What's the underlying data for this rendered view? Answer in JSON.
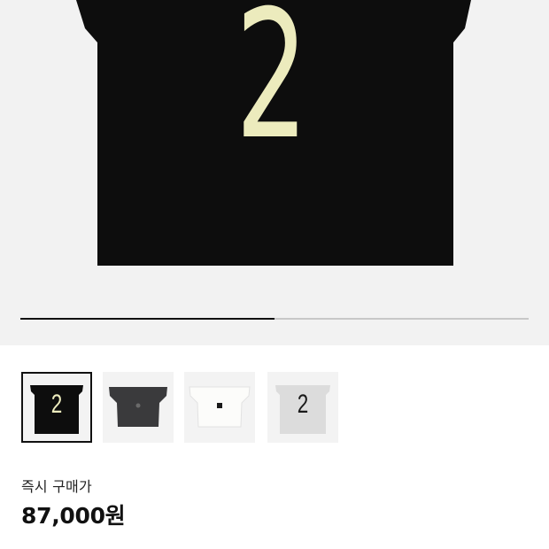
{
  "product": {
    "hero_number": "2",
    "image_progress_percent": 50
  },
  "thumbnails": [
    {
      "number": "2",
      "selected": true,
      "icon": "black-tshirt-front"
    },
    {
      "number": "",
      "selected": false,
      "icon": "charcoal-tshirt-back"
    },
    {
      "number": "",
      "selected": false,
      "icon": "white-tshirt"
    },
    {
      "number": "2",
      "selected": false,
      "icon": "grey-tshirt-front"
    }
  ],
  "price": {
    "label": "즉시 구매가",
    "value": "87,000원"
  },
  "colors": {
    "hero_background": "#f2f2f2",
    "shirt_black": "#0d0d0d",
    "number_cream": "#ecebbd",
    "progress_active": "#111111",
    "progress_track": "#c8c8c8"
  }
}
